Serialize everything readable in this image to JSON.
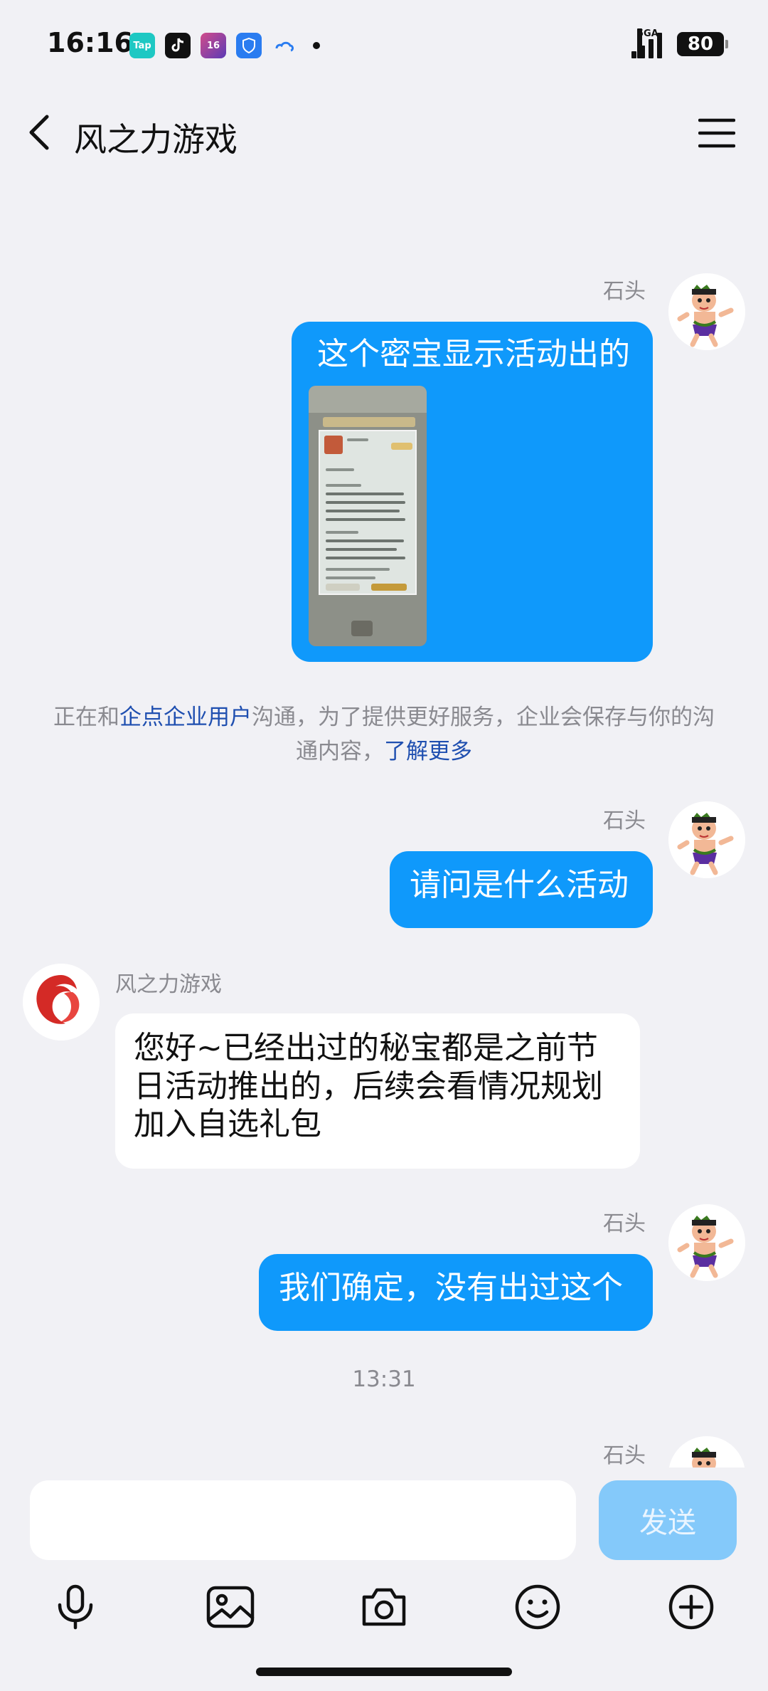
{
  "status_bar": {
    "time": "16:16",
    "apps": [
      "Tap",
      "",
      "16",
      "",
      ""
    ],
    "network": "5GA",
    "battery": "80"
  },
  "nav": {
    "title": "风之力游戏"
  },
  "messages": {
    "m1_sender": "石头",
    "m1_text": "这个密宝显示活动出的",
    "notice_before": "正在和",
    "notice_link1": "企点企业用户",
    "notice_after": "沟通，为了提供更好服务，企业会保存与你的沟通内容，",
    "notice_link2": "了解更多",
    "m2_sender": "石头",
    "m2_text": "请问是什么活动",
    "m3_sender": "风之力游戏",
    "m3_text": "您好~已经出过的秘宝都是之前节日活动推出的，后续会看情况规划加入自选礼包",
    "m4_sender": "石头",
    "m4_text": "我们确定，没有出过这个",
    "timestamp": "13:31",
    "m5_sender": "石头"
  },
  "input": {
    "value": "",
    "placeholder": "",
    "send_label": "发送"
  },
  "colors": {
    "outgoing_bubble": "#0f99fb",
    "send_button_disabled": "#84c9fa",
    "link": "#1f4fb0",
    "background": "#f1f1f5"
  },
  "icons": [
    "back-arrow-icon",
    "menu-icon",
    "microphone-icon",
    "image-icon",
    "camera-icon",
    "emoji-icon",
    "plus-circle-icon"
  ]
}
